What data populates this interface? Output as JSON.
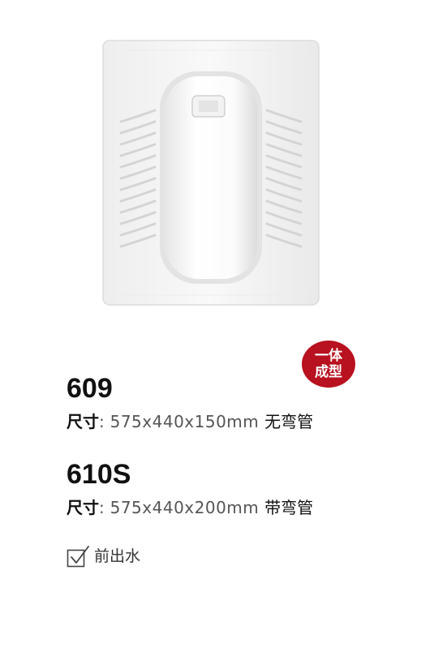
{
  "badge": {
    "line1": "一体",
    "line2": "成型",
    "color": "#b8111f"
  },
  "products": [
    {
      "model": "609",
      "size_label": "尺寸",
      "colon": ":",
      "dimensions": " 575x440x150mm ",
      "pipe": "无弯管"
    },
    {
      "model": "610S",
      "size_label": "尺寸",
      "colon": ":",
      "dimensions": " 575x440x200mm ",
      "pipe": "带弯管"
    }
  ],
  "outlet": {
    "label": "前出水",
    "icon": "checkbox-checked-icon"
  }
}
